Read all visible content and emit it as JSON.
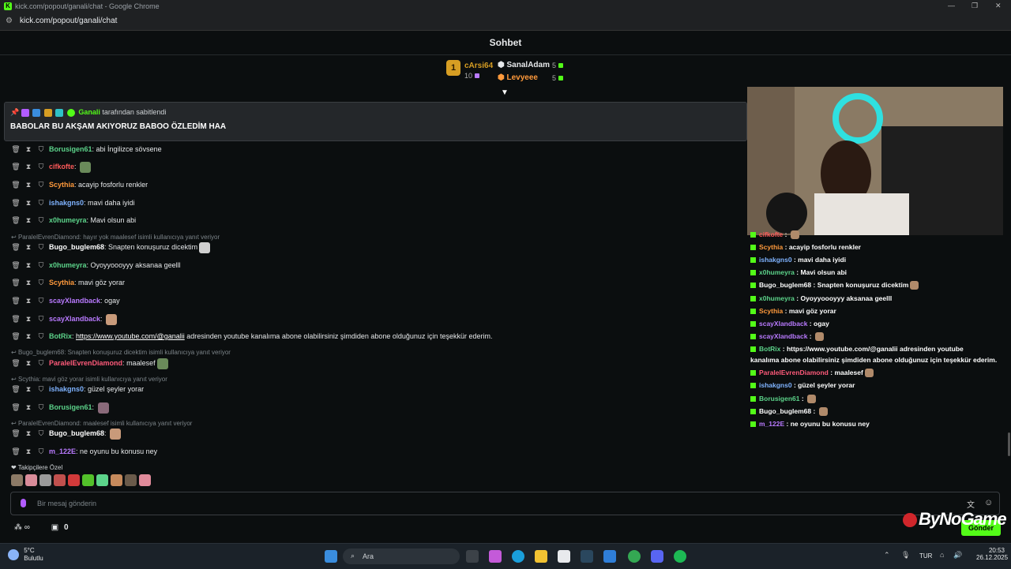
{
  "window": {
    "title": "kick.com/popout/ganali/chat - Google Chrome",
    "url": "kick.com/popout/ganali/chat"
  },
  "chat": {
    "title": "Sohbet"
  },
  "leaderboard": {
    "first": {
      "rank": "1",
      "name": "cArsi64",
      "count": "10"
    },
    "second": {
      "name": "SanalAdam",
      "count": "5"
    },
    "third": {
      "name": "Levyeee",
      "count": "5"
    }
  },
  "pinned": {
    "by_user": "Ganali",
    "by_suffix": "tarafından sabitlendi",
    "message": "BABOLAR BU AKŞAM AKIYORUZ BABOO ÖZLEDİM HAA"
  },
  "colors": {
    "kick_green": "#53fc18",
    "bg": "#0b0e0f",
    "pinned_bg": "#24272a"
  },
  "messages": [
    {
      "user": "Borusigen61",
      "color": "#5cd38a",
      "text": "abi İngilizce sövsene"
    },
    {
      "user": "cifkofte",
      "color": "#ff5a5a",
      "text": ""
    },
    {
      "user": "Scythia",
      "color": "#ff9a3c",
      "text": "acayip fosforlu renkler"
    },
    {
      "user": "ishakgns0",
      "color": "#7fb3ff",
      "text": "mavi daha iyidi"
    },
    {
      "user": "x0humeyra",
      "color": "#5cd38a",
      "text": "Mavi olsun abi"
    },
    {
      "user": "Bugo_buglem68",
      "color": "#ffffff",
      "text": "Snapten konuşuruz dicektim",
      "reply": "ParalelEvrenDiamond: hayır yok maalesef  isimli kullanıcıya yanıt veriyor"
    },
    {
      "user": "x0humeyra",
      "color": "#5cd38a",
      "text": "Oyoyyoooyyy aksanaa geelll"
    },
    {
      "user": "Scythia",
      "color": "#ff9a3c",
      "text": "mavi göz yorar"
    },
    {
      "user": "scayXlandback",
      "color": "#b97aff",
      "text": "ogay"
    },
    {
      "user": "scayXlandback",
      "color": "#b97aff",
      "text": ""
    },
    {
      "user": "BotRix",
      "color": "#5cd38a",
      "link": "https://www.youtube.com/@ganalii",
      "text": "adresinden youtube kanalıma abone olabilirsiniz şimdiden abone olduğunuz için teşekkür ederim."
    },
    {
      "user": "ParalelEvrenDiamond",
      "color": "#ff5a7a",
      "text": "maalesef",
      "reply": "Bugo_buglem68: Snapten konuşuruz dicektim  isimli kullanıcıya yanıt veriyor"
    },
    {
      "user": "ishakgns0",
      "color": "#7fb3ff",
      "text": "güzel şeyler yorar",
      "reply": "Scythia: mavi göz yorar isimli kullanıcıya yanıt veriyor"
    },
    {
      "user": "Borusigen61",
      "color": "#5cd38a",
      "text": ""
    },
    {
      "user": "Bugo_buglem68",
      "color": "#ffffff",
      "text": "",
      "reply": "ParalelEvrenDiamond: maalesef  isimli kullanıcıya yanıt veriyor"
    },
    {
      "user": "m_122E",
      "color": "#b97aff",
      "text": "ne oyunu bu konusu ney"
    }
  ],
  "follow_label": "Takipçilere Özel",
  "input": {
    "placeholder": "Bir mesaj gönderin",
    "send_label": "Gönder"
  },
  "bottom": {
    "count": "0"
  },
  "overlay": {
    "logo": "ByNoGame",
    "messages": [
      {
        "user": "cifkofte",
        "color": "#ff5a5a",
        "text": ""
      },
      {
        "user": "Scythia",
        "color": "#ff9a3c",
        "text": "acayip fosforlu renkler"
      },
      {
        "user": "ishakgns0",
        "color": "#7fb3ff",
        "text": "mavi daha iyidi"
      },
      {
        "user": "x0humeyra",
        "color": "#5cd38a",
        "text": "Mavi olsun abi"
      },
      {
        "user": "Bugo_buglem68",
        "color": "#ffffff",
        "text": "Snapten konuşuruz dicektim"
      },
      {
        "user": "x0humeyra",
        "color": "#5cd38a",
        "text": "Oyoyyoooyyy aksanaa geelll"
      },
      {
        "user": "Scythia",
        "color": "#ff9a3c",
        "text": "mavi göz yorar"
      },
      {
        "user": "scayXlandback",
        "color": "#b97aff",
        "text": "ogay"
      },
      {
        "user": "scayXlandback",
        "color": "#b97aff",
        "text": ""
      },
      {
        "user": "BotRix",
        "color": "#5cd38a",
        "text": "https://www.youtube.com/@ganalii adresinden youtube"
      },
      {
        "user": "",
        "color": "#ffffff",
        "text": "kanalıma abone olabilirsiniz şimdiden abone olduğunuz için teşekkür ederim."
      },
      {
        "user": "ParalelEvrenDiamond",
        "color": "#ff5a7a",
        "text": "maalesef"
      },
      {
        "user": "ishakgns0",
        "color": "#7fb3ff",
        "text": "güzel şeyler yorar"
      },
      {
        "user": "Borusigen61",
        "color": "#5cd38a",
        "text": ""
      },
      {
        "user": "Bugo_buglem68",
        "color": "#ffffff",
        "text": ""
      },
      {
        "user": "m_122E",
        "color": "#b97aff",
        "text": "ne oyunu bu konusu ney"
      }
    ]
  },
  "taskbar": {
    "temp": "5°C",
    "weather": "Bulutlu",
    "search": "Ara",
    "lang": "TUR",
    "time": "20:53",
    "date": "26.12.2025"
  }
}
